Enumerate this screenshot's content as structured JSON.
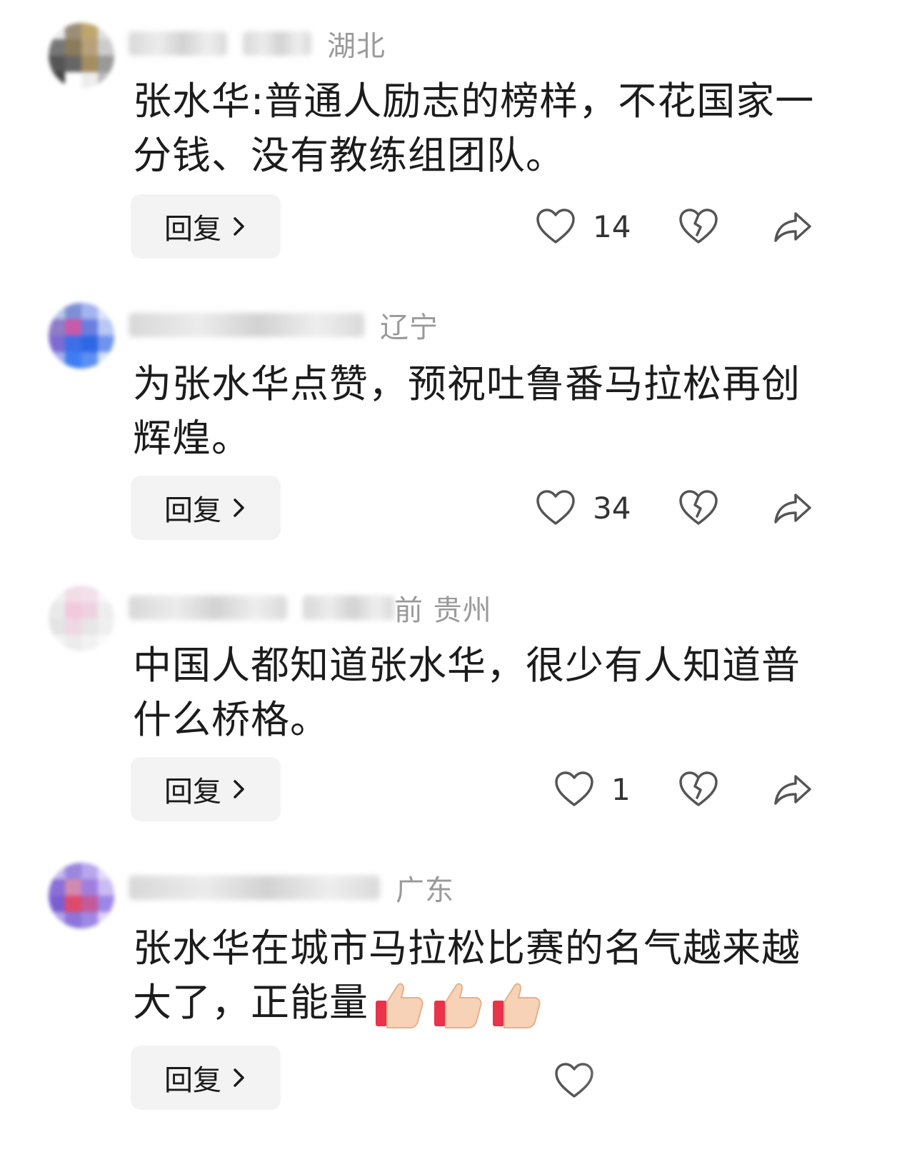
{
  "comments": [
    {
      "region": "湖北",
      "text": "张水华:普通人励志的榜样，不花国家一分钱、没有教练组团队。",
      "reply_label": "回复",
      "likes": "14"
    },
    {
      "region": "辽宁",
      "text": "为张水华点赞，预祝吐鲁番马拉松再创辉煌。",
      "reply_label": "回复",
      "likes": "34"
    },
    {
      "region": "前  贵州",
      "text": "中国人都知道张水华，很少有人知道普什么桥格。",
      "reply_label": "回复",
      "likes": "1"
    },
    {
      "region": "广东",
      "text": "张水华在城市马拉松比赛的名气越来越大了，正能量",
      "reply_label": "回复",
      "likes": ""
    }
  ],
  "icons": {
    "like": "heart-outline-icon",
    "dislike": "broken-heart-icon",
    "share": "share-arrow-icon",
    "reply_chevron": "chevron-right-icon",
    "emoji": "thumbs-up-emoji"
  },
  "colors": {
    "text": "#1c1c1c",
    "region": "#9a9a9a",
    "reply_bg": "#f3f3f3",
    "icon": "#555555"
  }
}
